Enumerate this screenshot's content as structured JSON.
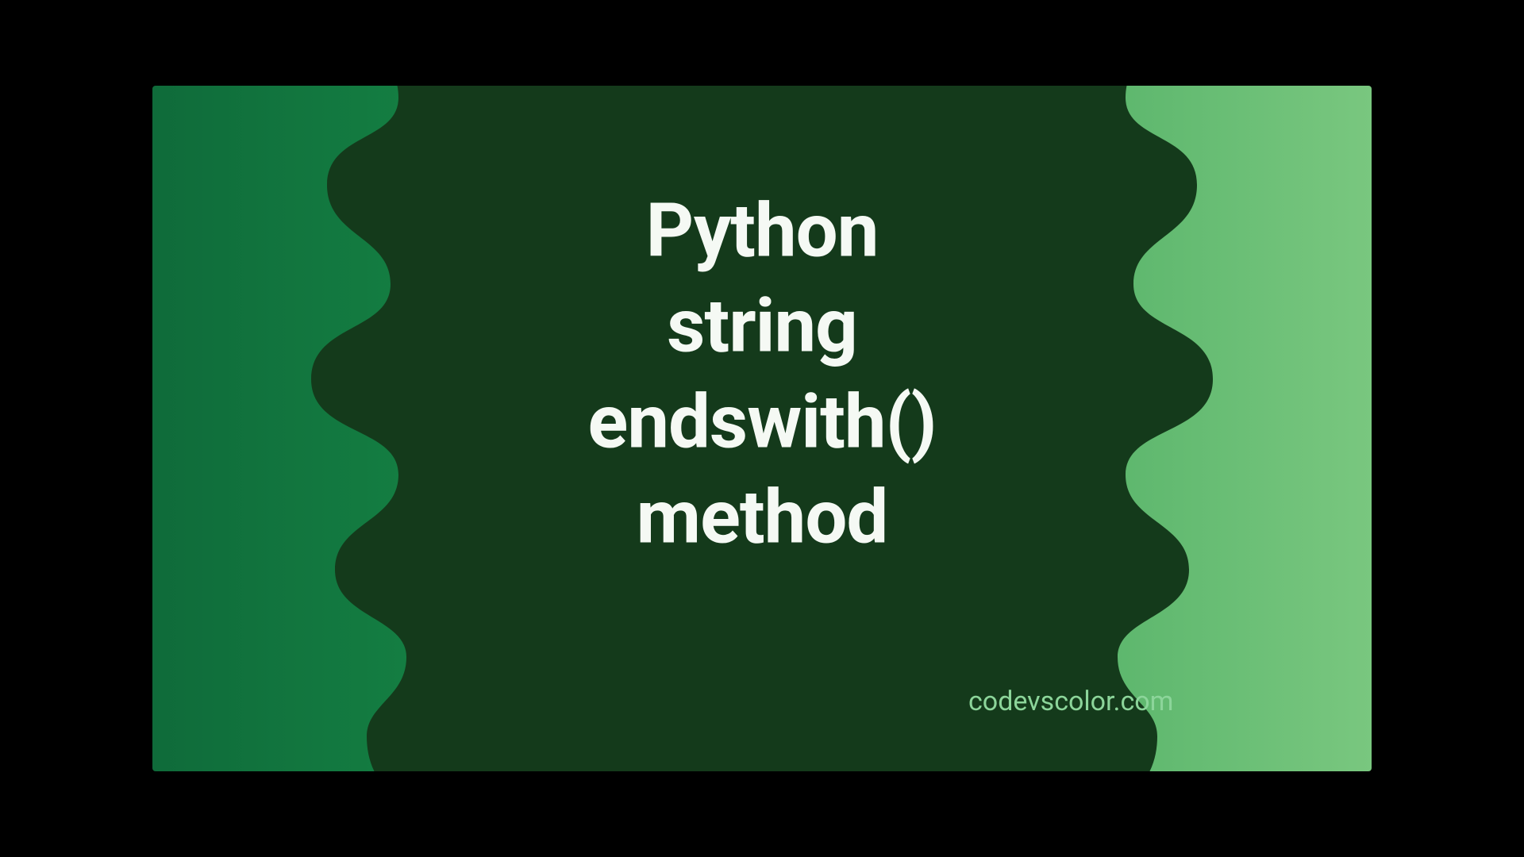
{
  "title_line1": "Python",
  "title_line2": "string",
  "title_line3": "endswith()",
  "title_line4": "method",
  "watermark": "codevscolor.com",
  "colors": {
    "blob": "#143a1b",
    "gradient_start": "#0f6b3a",
    "gradient_end": "#79c77f",
    "text": "#f5f9f4",
    "watermark": "#8cd59a"
  }
}
